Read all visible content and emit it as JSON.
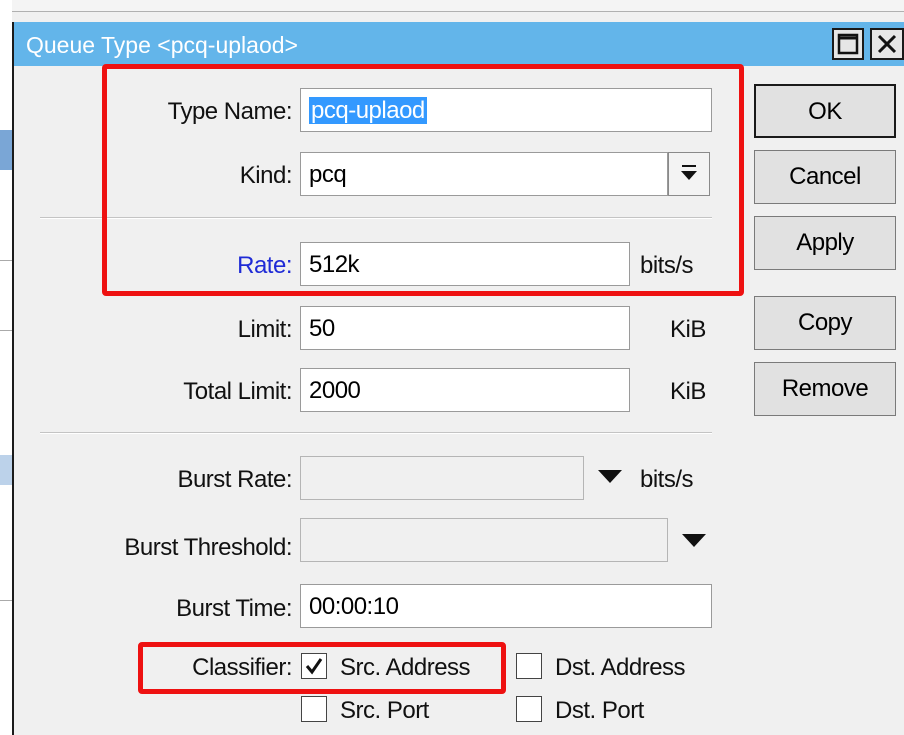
{
  "window": {
    "title": "Queue Type <pcq-uplaod>"
  },
  "form": {
    "type_name": {
      "label": "Type Name:",
      "value": "pcq-uplaod"
    },
    "kind": {
      "label": "Kind:",
      "value": "pcq"
    },
    "rate": {
      "label": "Rate:",
      "value": "512k",
      "unit": "bits/s"
    },
    "limit": {
      "label": "Limit:",
      "value": "50",
      "unit": "KiB"
    },
    "total_limit": {
      "label": "Total Limit:",
      "value": "2000",
      "unit": "KiB"
    },
    "burst_rate": {
      "label": "Burst Rate:",
      "value": "",
      "unit": "bits/s"
    },
    "burst_threshold": {
      "label": "Burst Threshold:",
      "value": ""
    },
    "burst_time": {
      "label": "Burst Time:",
      "value": "00:00:10"
    },
    "classifier": {
      "label": "Classifier:",
      "options": [
        {
          "label": "Src. Address",
          "checked": true
        },
        {
          "label": "Dst. Address",
          "checked": false
        },
        {
          "label": "Src. Port",
          "checked": false
        },
        {
          "label": "Dst. Port",
          "checked": false
        }
      ]
    }
  },
  "buttons": {
    "ok": "OK",
    "cancel": "Cancel",
    "apply": "Apply",
    "copy": "Copy",
    "remove": "Remove"
  },
  "colors": {
    "titlebar": "#63b5ea",
    "highlight": "#ee1111",
    "rate_label": "#1f2bd6",
    "selection": "#3399ff"
  }
}
